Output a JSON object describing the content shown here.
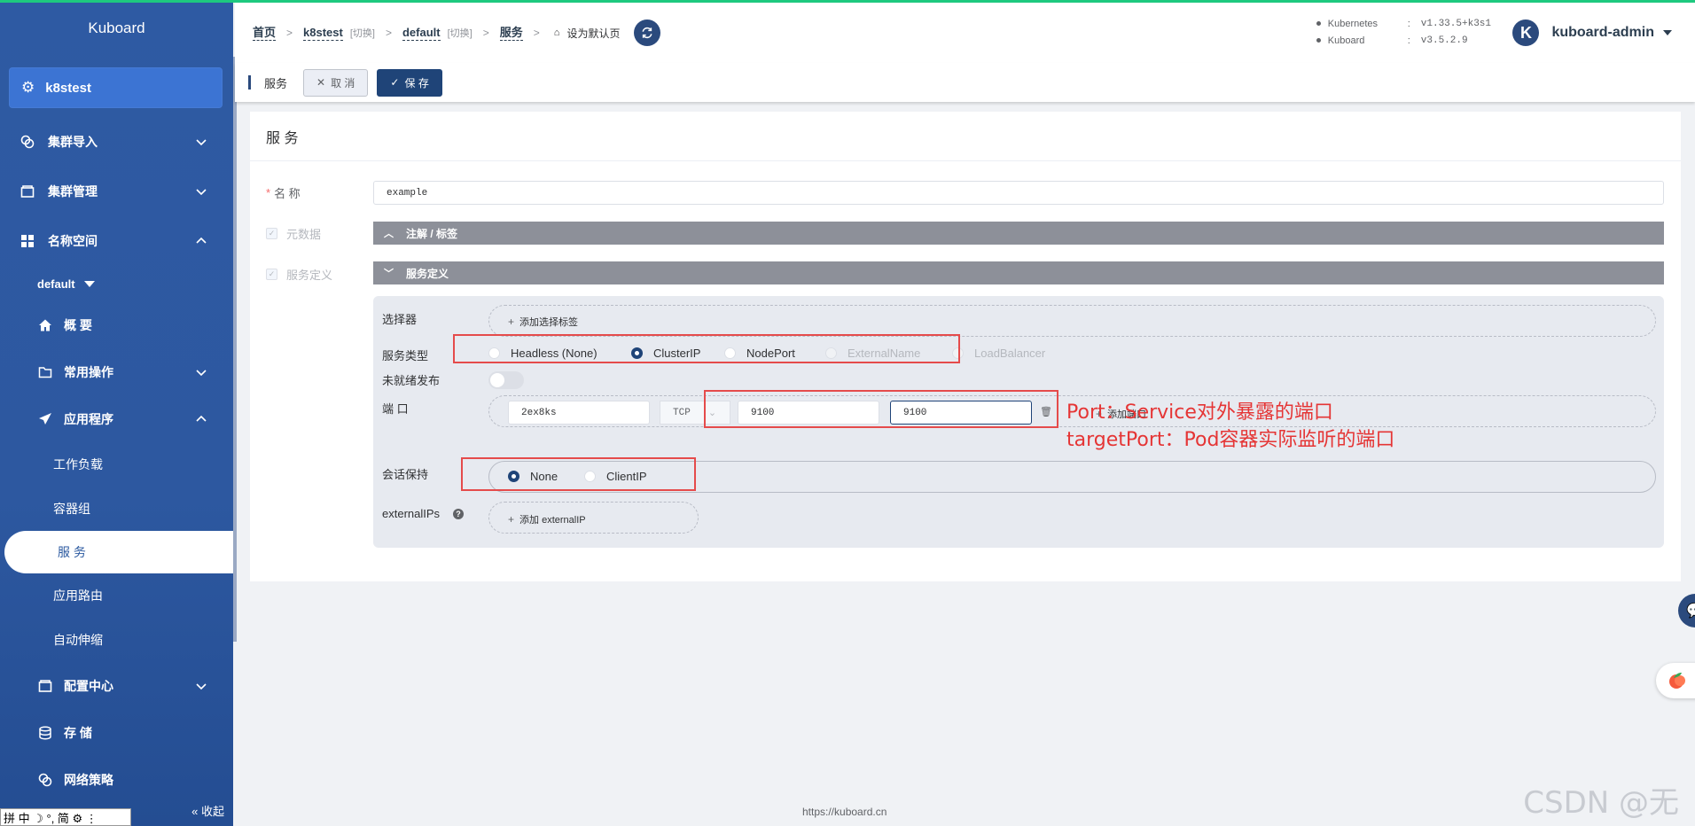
{
  "sidebar": {
    "brand": "Kuboard",
    "cluster": "k8stest",
    "items": [
      {
        "label": "集群导入"
      },
      {
        "label": "集群管理"
      },
      {
        "label": "名称空间"
      }
    ],
    "namespace": "default",
    "ns_items": [
      {
        "label": "概 要"
      },
      {
        "label": "常用操作"
      },
      {
        "label": "应用程序"
      }
    ],
    "app_leaves": [
      "工作负载",
      "容器组",
      "服 务",
      "应用路由",
      "自动伸缩"
    ],
    "bottom_items": [
      {
        "label": "配置中心"
      },
      {
        "label": "存 储"
      },
      {
        "label": "网络策略"
      }
    ],
    "collapse": "收起"
  },
  "ime": {
    "text": "拼 中 ☽ °, 简 ⚙ ⋮"
  },
  "header": {
    "crumbs": [
      {
        "label": "首页"
      },
      {
        "label": "k8stest",
        "switch": "[切换]"
      },
      {
        "label": "default",
        "switch": "[切换]"
      },
      {
        "label": "服务"
      }
    ],
    "set_default": "设为默认页",
    "versions": [
      {
        "name": "Kubernetes",
        "value": "v1.33.5+k3s1"
      },
      {
        "name": "Kuboard",
        "value": "v3.5.2.9"
      }
    ],
    "user": "kuboard-admin",
    "avatar_letter": "K"
  },
  "toolbar": {
    "title": "服务",
    "cancel": "取 消",
    "save": "保 存"
  },
  "form": {
    "card_title": "服 务",
    "name_label": "名 称",
    "name_required": "*",
    "name_value": "example",
    "meta_label": "元数据",
    "meta_bar": "注解 / 标签",
    "svcdef_label": "服务定义",
    "svcdef_bar": "服务定义",
    "selector_label": "选择器",
    "add_selector": "添加选择标签",
    "type_label": "服务类型",
    "types": [
      "Headless (None)",
      "ClusterIP",
      "NodePort",
      "ExternalName",
      "LoadBalancer"
    ],
    "selected_type": "ClusterIP",
    "unready_label": "未就绪发布",
    "port_label": "端 口",
    "port": {
      "name": "2ex8ks",
      "protocol": "TCP",
      "port": "9100",
      "target_port": "9100"
    },
    "add_port": "添加端口",
    "session_label": "会话保持",
    "session_options": [
      "None",
      "ClientIP"
    ],
    "selected_session": "None",
    "externalips_label": "externalIPs",
    "add_externalip": "添加 externalIP"
  },
  "annotation": {
    "line1": "Port：Service对外暴露的端口",
    "line2": "targetPort：Pod容器实际监听的端口",
    "color": "#e53535"
  },
  "footer": {
    "url": "https://kuboard.cn"
  },
  "watermark": "CSDN @无",
  "colors": {
    "sidebar": "#2e5aa3",
    "primary": "#1f4478",
    "accent_top": "#1ec97f"
  }
}
